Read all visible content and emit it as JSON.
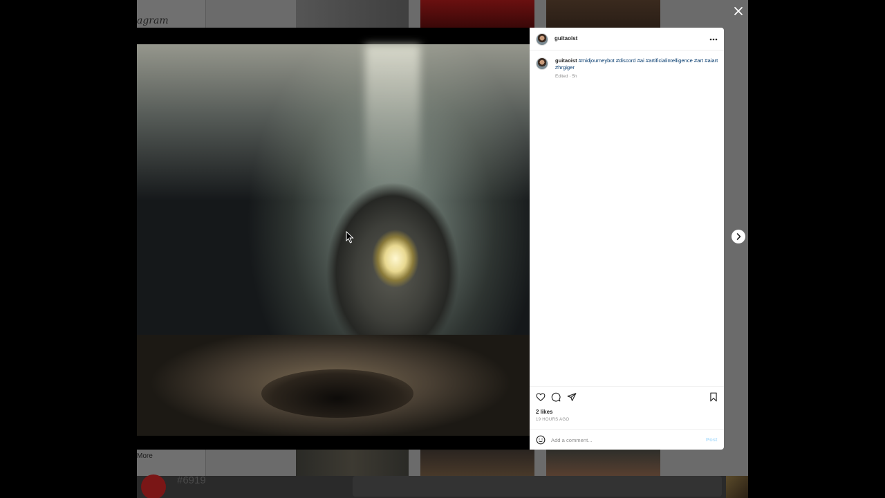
{
  "background": {
    "logo_text": "agram",
    "more_label": "More",
    "bottom_number": "#6919"
  },
  "post": {
    "username": "guitaoist",
    "options_icon": "more-horizontal-icon",
    "caption": {
      "username": "guitaoist",
      "hashtags": [
        "#midjourneybot",
        "#discord",
        "#ai",
        "#artificialintelligence",
        "#art",
        "#aiart",
        "#hrgiger"
      ],
      "meta": "Edited · 5h"
    },
    "likes": "2 likes",
    "timestamp": "19 HOURS AGO",
    "comment_placeholder": "Add a comment...",
    "post_label": "Post"
  },
  "colors": {
    "accent_link": "#00376b",
    "post_disabled": "#b2dffc",
    "text": "#262626",
    "muted": "#8e8e8e"
  }
}
